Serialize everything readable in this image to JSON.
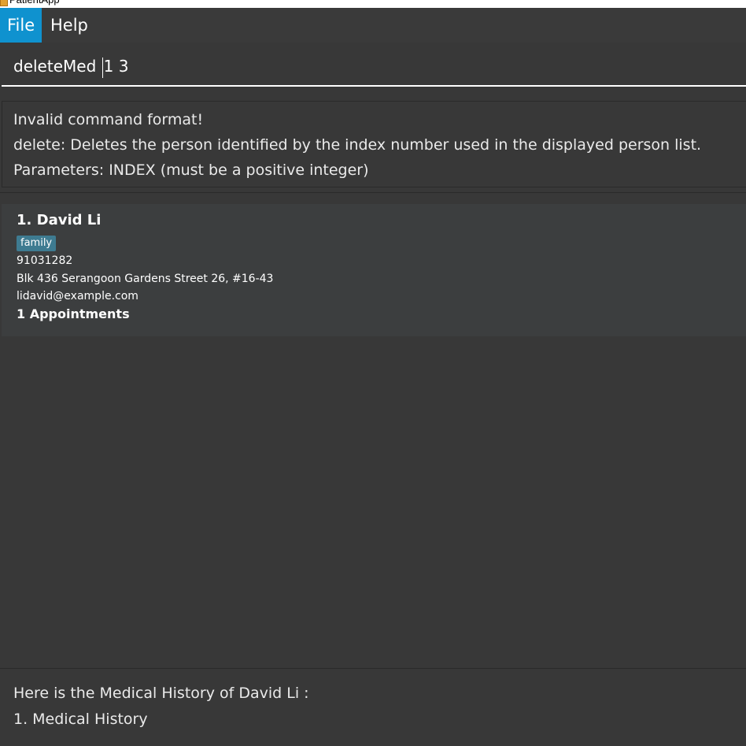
{
  "window": {
    "title": "PatientApp"
  },
  "menu": {
    "items": [
      {
        "label": "File"
      },
      {
        "label": "Help"
      }
    ]
  },
  "command": {
    "before_caret": "deleteMed ",
    "after_caret": "1 3"
  },
  "result": {
    "lines": [
      "Invalid command format!",
      "delete: Deletes the person identified by the index number used in the displayed person list.",
      "Parameters: INDEX (must be a positive integer)"
    ]
  },
  "persons": [
    {
      "name": "1.  David Li",
      "tag": "family",
      "phone": "91031282",
      "address": "Blk 436 Serangoon Gardens Street 26, #16-43",
      "email": "lidavid@example.com",
      "appointments": "1 Appointments"
    }
  ],
  "history": {
    "lines": [
      "Here is the Medical History of David Li :",
      "1. Medical History"
    ]
  },
  "colors": {
    "background": "#383838",
    "menu_selected": "#0f92cf",
    "card": "#3c3e3f",
    "tag": "#3e7b91"
  }
}
